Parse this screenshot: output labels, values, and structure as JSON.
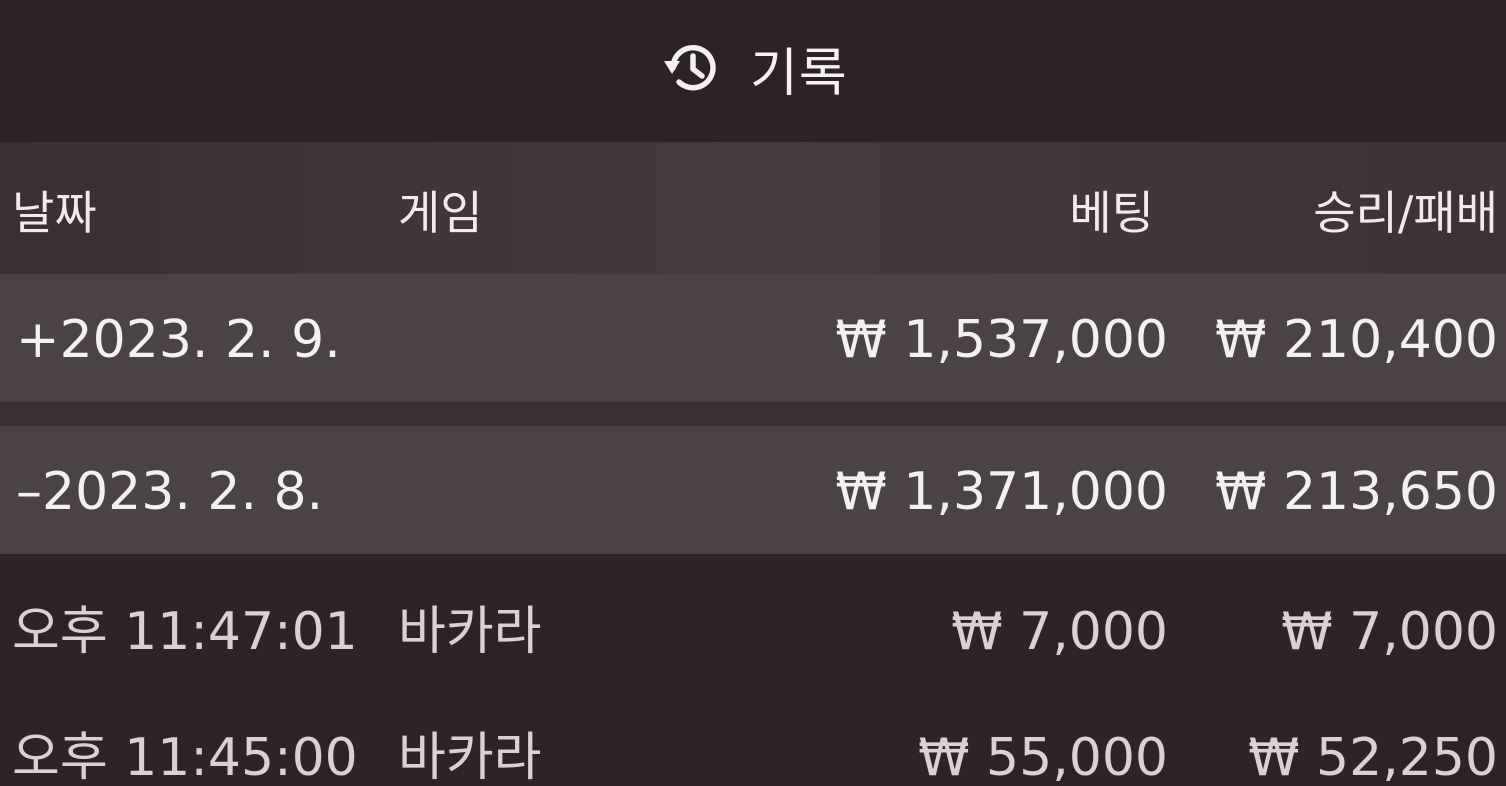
{
  "titlebar": {
    "title": "기록",
    "icon": "history-icon"
  },
  "table": {
    "headers": {
      "date": "날짜",
      "game": "게임",
      "bet": "베팅",
      "win_loss": "승리/패배"
    },
    "groups": [
      {
        "date": "+2023. 2. 9.",
        "bet": "₩ 1,537,000",
        "win_loss": "₩ 210,400"
      },
      {
        "date": "–2023. 2. 8.",
        "bet": "₩ 1,371,000",
        "win_loss": "₩ 213,650"
      }
    ],
    "entries": [
      {
        "time": "오후 11:47:01",
        "game": "바카라",
        "bet": "₩ 7,000",
        "win_loss": "₩ 7,000"
      },
      {
        "time": "오후 11:45:00",
        "game": "바카라",
        "bet": "₩ 55,000",
        "win_loss": "₩ 52,250"
      }
    ]
  }
}
